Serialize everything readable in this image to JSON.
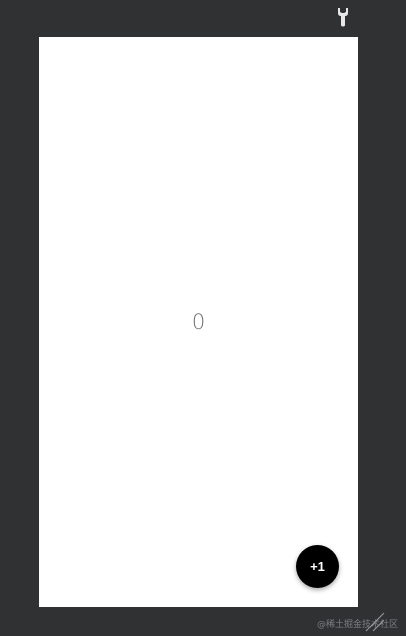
{
  "toolbar": {
    "tool_icon": "wrench-icon"
  },
  "app": {
    "counter_value": "0",
    "fab_label": "+1"
  },
  "colors": {
    "background": "#2f3133",
    "screen": "#ffffff",
    "fab": "#000000",
    "counter_text": "#6e6e6e"
  },
  "footer": {
    "watermark": "@稀土掘金技术社区"
  }
}
